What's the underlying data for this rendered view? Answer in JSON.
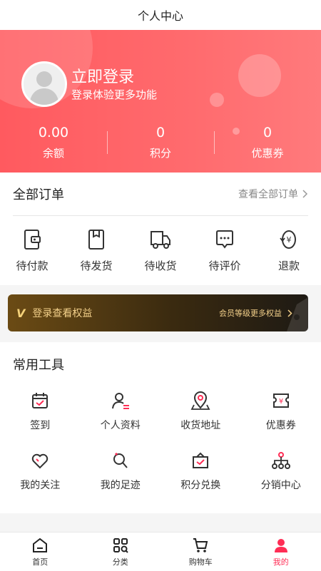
{
  "titlebar": {
    "title": "个人中心"
  },
  "colors": {
    "accent": "#ff5a5f",
    "active_tab": "#ff2d55",
    "gold": "#f3d08a"
  },
  "profile": {
    "avatar_icon": "default-avatar-icon",
    "login_title": "立即登录",
    "login_subtitle": "登录体验更多功能",
    "stats": [
      {
        "value": "0.00",
        "label": "余额"
      },
      {
        "value": "0",
        "label": "积分"
      },
      {
        "value": "0",
        "label": "优惠券"
      }
    ]
  },
  "orders": {
    "title": "全部订单",
    "view_all": "查看全部订单",
    "items": [
      {
        "label": "待付款",
        "icon": "wallet-icon"
      },
      {
        "label": "待发货",
        "icon": "package-icon"
      },
      {
        "label": "待收货",
        "icon": "truck-icon"
      },
      {
        "label": "待评价",
        "icon": "comment-icon"
      },
      {
        "label": "退款",
        "icon": "refund-icon"
      }
    ]
  },
  "vip": {
    "badge": "V",
    "text": "登录查看权益",
    "right_text": "会员等级更多权益"
  },
  "tools": {
    "title": "常用工具",
    "items": [
      {
        "label": "签到",
        "icon": "calendar-check-icon"
      },
      {
        "label": "个人资料",
        "icon": "user-profile-icon"
      },
      {
        "label": "收货地址",
        "icon": "location-icon"
      },
      {
        "label": "优惠券",
        "icon": "coupon-icon"
      },
      {
        "label": "我的关注",
        "icon": "heart-icon"
      },
      {
        "label": "我的足迹",
        "icon": "footprint-icon"
      },
      {
        "label": "积分兑换",
        "icon": "gift-icon"
      },
      {
        "label": "分销中心",
        "icon": "distribution-icon"
      }
    ]
  },
  "tabbar": {
    "items": [
      {
        "label": "首页",
        "icon": "home-icon"
      },
      {
        "label": "分类",
        "icon": "category-icon"
      },
      {
        "label": "购物车",
        "icon": "cart-icon"
      },
      {
        "label": "我的",
        "icon": "user-icon",
        "active": true
      }
    ]
  }
}
